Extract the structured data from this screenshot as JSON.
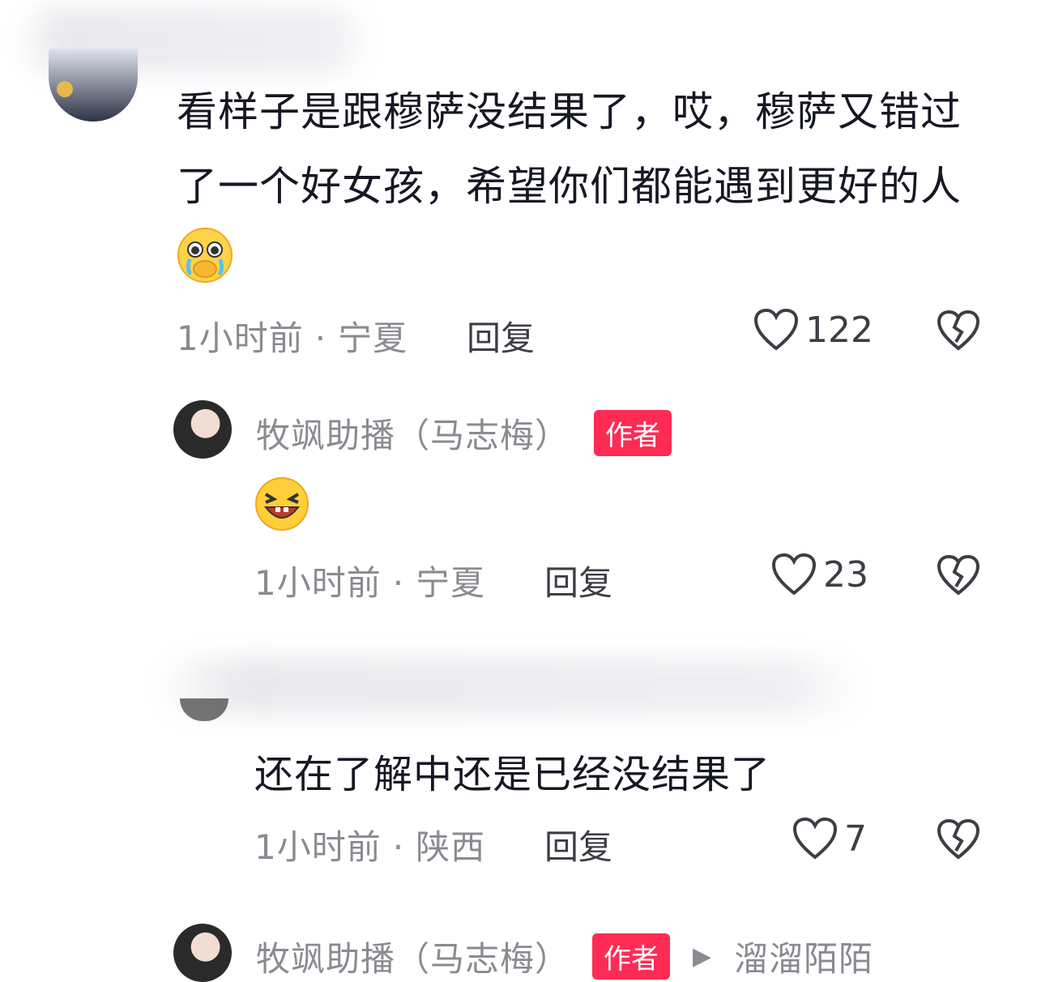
{
  "comment1": {
    "text_line1": "看样子是跟穆萨没结果了，哎，穆萨又错过",
    "text_line2": "了一个好女孩，希望你们都能遇到更好的人",
    "emoji": "crying-face-emoji",
    "time": "1小时前",
    "location": "宁夏",
    "reply_label": "回复",
    "likes": "122"
  },
  "reply1": {
    "author": "牧飒助播（马志梅）",
    "badge": "作者",
    "emoji": "laughing-face-emoji",
    "time": "1小时前",
    "location": "宁夏",
    "reply_label": "回复",
    "likes": "23"
  },
  "reply2": {
    "text": "还在了解中还是已经没结果了",
    "time": "1小时前",
    "location": "陕西",
    "reply_label": "回复",
    "likes": "7"
  },
  "reply3": {
    "author": "牧飒助播（马志梅）",
    "badge": "作者",
    "target": "溜溜陌陌"
  },
  "separator": "·",
  "colors": {
    "badge": "#fe2c55",
    "meta": "#8a8b91",
    "text": "#161823"
  },
  "icons": [
    "heart-outline-icon",
    "broken-heart-icon"
  ]
}
